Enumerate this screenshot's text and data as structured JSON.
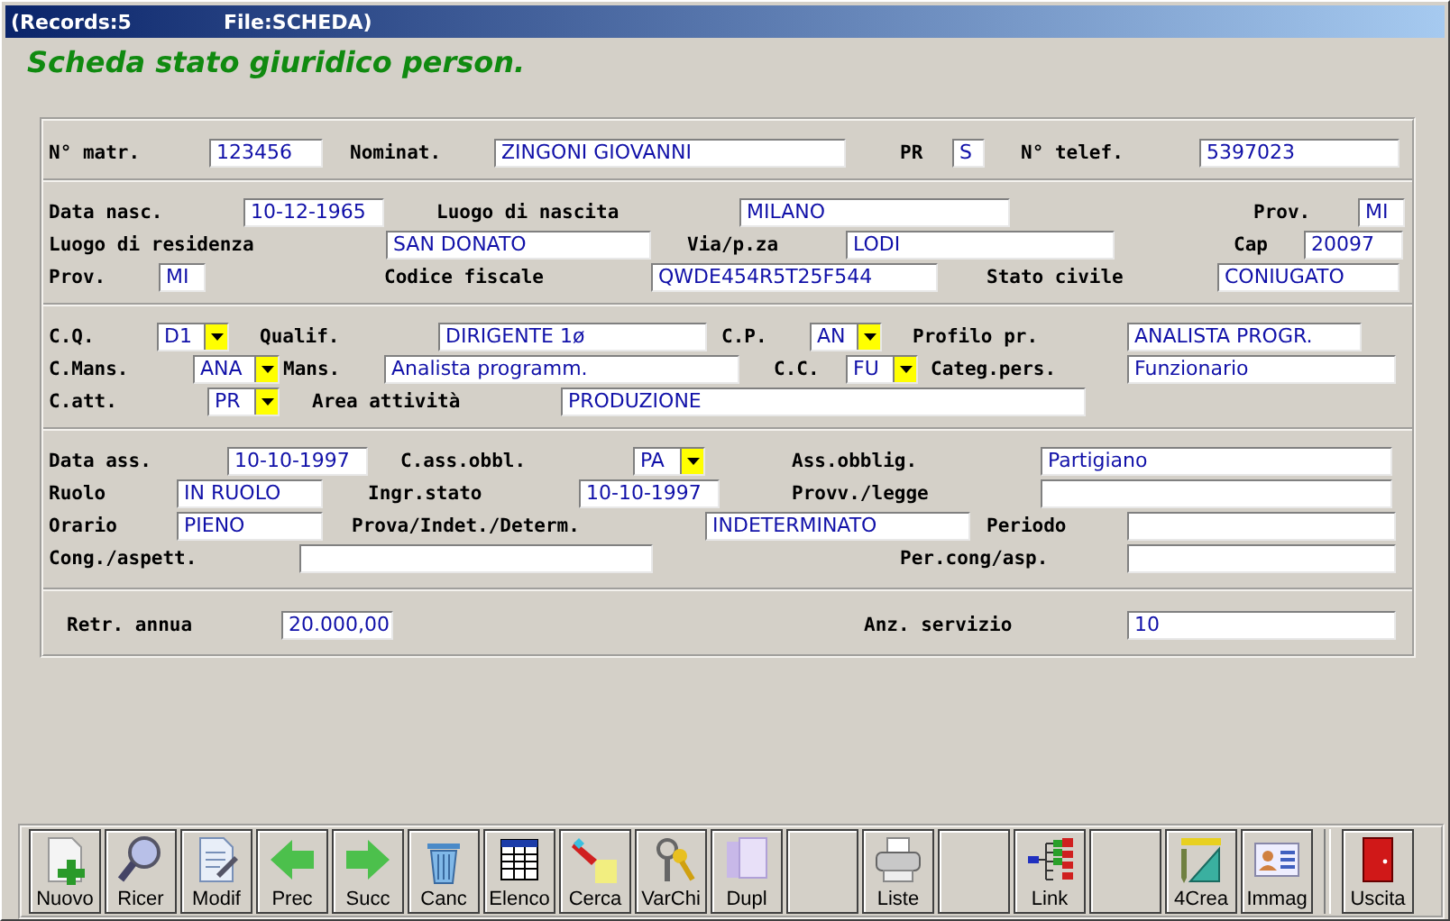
{
  "window": {
    "records": "(Records:5",
    "file": "File:SCHEDA)"
  },
  "heading": "Scheda stato giuridico person.",
  "sections": [
    {
      "fields": [
        {
          "kind": "text",
          "label": "N° matr.",
          "value": "123456"
        },
        {
          "kind": "text",
          "label": "Nominat.",
          "value": "ZINGONI GIOVANNI"
        },
        {
          "kind": "text",
          "label": "PR",
          "value": "S"
        },
        {
          "kind": "text",
          "label": "N° telef.",
          "value": "5397023"
        }
      ]
    },
    {
      "fields": [
        {
          "kind": "text",
          "label": "Data nasc.",
          "value": "10-12-1965"
        },
        {
          "kind": "text",
          "label": "Luogo di nascita",
          "value": "MILANO"
        },
        {
          "kind": "text",
          "label": "Prov.",
          "value": "MI"
        },
        {
          "kind": "text",
          "label": "Luogo di residenza",
          "value": "SAN DONATO"
        },
        {
          "kind": "text",
          "label": "Via/p.za",
          "value": "LODI"
        },
        {
          "kind": "text",
          "label": "Cap",
          "value": "20097"
        },
        {
          "kind": "text",
          "label": "Prov.",
          "value": "MI"
        },
        {
          "kind": "text",
          "label": "Codice fiscale",
          "value": "QWDE454R5T25F544"
        },
        {
          "kind": "text",
          "label": "Stato civile",
          "value": "CONIUGATO"
        }
      ]
    },
    {
      "fields": [
        {
          "kind": "combo",
          "label": "C.Q.",
          "value": "D1"
        },
        {
          "kind": "text",
          "label": "Qualif.",
          "value": "DIRIGENTE 1ø"
        },
        {
          "kind": "combo",
          "label": "C.P.",
          "value": "AN"
        },
        {
          "kind": "text",
          "label": "Profilo pr.",
          "value": "ANALISTA PROGR."
        },
        {
          "kind": "combo",
          "label": "C.Mans.",
          "value": "ANA"
        },
        {
          "kind": "text",
          "label": "Mans.",
          "value": "Analista programm."
        },
        {
          "kind": "combo",
          "label": "C.C.",
          "value": "FU"
        },
        {
          "kind": "text",
          "label": "Categ.pers.",
          "value": "Funzionario"
        },
        {
          "kind": "combo",
          "label": "C.att.",
          "value": "PR"
        },
        {
          "kind": "text",
          "label": "Area attività",
          "value": "PRODUZIONE"
        }
      ]
    },
    {
      "fields": [
        {
          "kind": "text",
          "label": "Data ass.",
          "value": "10-10-1997"
        },
        {
          "kind": "combo",
          "label": "C.ass.obbl.",
          "value": "PA"
        },
        {
          "kind": "text",
          "label": "Ass.obblig.",
          "value": "Partigiano"
        },
        {
          "kind": "text",
          "label": "Ruolo",
          "value": "IN RUOLO"
        },
        {
          "kind": "text",
          "label": "Ingr.stato",
          "value": "10-10-1997"
        },
        {
          "kind": "text",
          "label": "Provv./legge"
        },
        {
          "kind": "text",
          "label": "Orario",
          "value": "PIENO"
        },
        {
          "kind": "text",
          "label": "Prova/Indet./Determ.",
          "value": "INDETERMINATO"
        },
        {
          "kind": "text",
          "label": "Periodo"
        },
        {
          "kind": "text",
          "label": "Cong./aspett."
        },
        {
          "kind": "text",
          "label": "Per.cong/asp."
        }
      ]
    },
    {
      "fields": [
        {
          "kind": "text",
          "label": "Retr. annua",
          "value": "20.000,00"
        },
        {
          "kind": "text",
          "label": "Anz. servizio",
          "value": "10"
        }
      ]
    }
  ],
  "toolbar": [
    {
      "kind": "button",
      "label": "Nuovo"
    },
    {
      "kind": "button",
      "label": "Ricer"
    },
    {
      "kind": "button",
      "label": "Modif"
    },
    {
      "kind": "button",
      "label": "Prec"
    },
    {
      "kind": "button",
      "label": "Succ"
    },
    {
      "kind": "button",
      "label": "Canc"
    },
    {
      "kind": "button",
      "label": "Elenco"
    },
    {
      "kind": "button",
      "label": "Cerca"
    },
    {
      "kind": "button",
      "label": "VarChi"
    },
    {
      "kind": "button",
      "label": "Dupl"
    },
    {
      "kind": "blank"
    },
    {
      "kind": "button",
      "label": "Liste"
    },
    {
      "kind": "blank"
    },
    {
      "kind": "button",
      "label": "Link"
    },
    {
      "kind": "blank"
    },
    {
      "kind": "button",
      "label": "4Crea"
    },
    {
      "kind": "button",
      "label": "Immag"
    },
    {
      "kind": "button",
      "label": "Uscita"
    }
  ]
}
